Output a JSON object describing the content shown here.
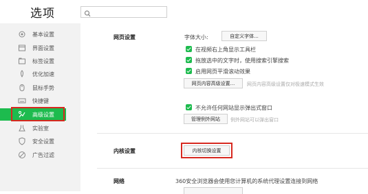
{
  "header": {
    "title": "选项",
    "search_placeholder": ""
  },
  "sidebar": {
    "items": [
      {
        "label": "基本设置",
        "icon": "gear-icon"
      },
      {
        "label": "界面设置",
        "icon": "window-icon"
      },
      {
        "label": "标签设置",
        "icon": "tab-icon"
      },
      {
        "label": "优化加速",
        "icon": "rocket-icon"
      },
      {
        "label": "鼠标手势",
        "icon": "mouse-icon"
      },
      {
        "label": "快捷键",
        "icon": "keyboard-icon"
      },
      {
        "label": "高级设置",
        "icon": "advanced-icon",
        "active": true
      },
      {
        "label": "实验室",
        "icon": "lab-icon"
      },
      {
        "label": "安全设置",
        "icon": "shield-icon"
      },
      {
        "label": "广告过滤",
        "icon": "block-icon"
      }
    ],
    "active_color": "#1dbb4e"
  },
  "web_settings": {
    "title": "网页设置",
    "font_size_label": "字体大小:",
    "custom_font_button": "自定义字体...",
    "checkboxes": [
      {
        "label": "在视频右上角显示工具栏",
        "checked": true
      },
      {
        "label": "拖放选中的文字时，使用搜索引擎搜索",
        "checked": true
      },
      {
        "label": "启用网页平滑滚动效果",
        "checked": true
      }
    ],
    "advanced_content_button": "网页内容高级设置...",
    "advanced_content_hint": "网页内容高级设置仅对极速模式生效",
    "popup_checkbox": {
      "label": "不允许任何网站显示弹出式窗口",
      "checked": true
    },
    "exceptions_button": "管理例外网站",
    "exceptions_hint": "例外网站可以弹出窗口"
  },
  "kernel_settings": {
    "title": "内核设置",
    "switch_button": "内核切换设置"
  },
  "network_settings": {
    "title": "网络",
    "description": "360安全浏览器会使用您计算机的系统代理设置连接到网络"
  },
  "colors": {
    "accent": "#1dbb4e",
    "highlight": "#d7281f"
  }
}
